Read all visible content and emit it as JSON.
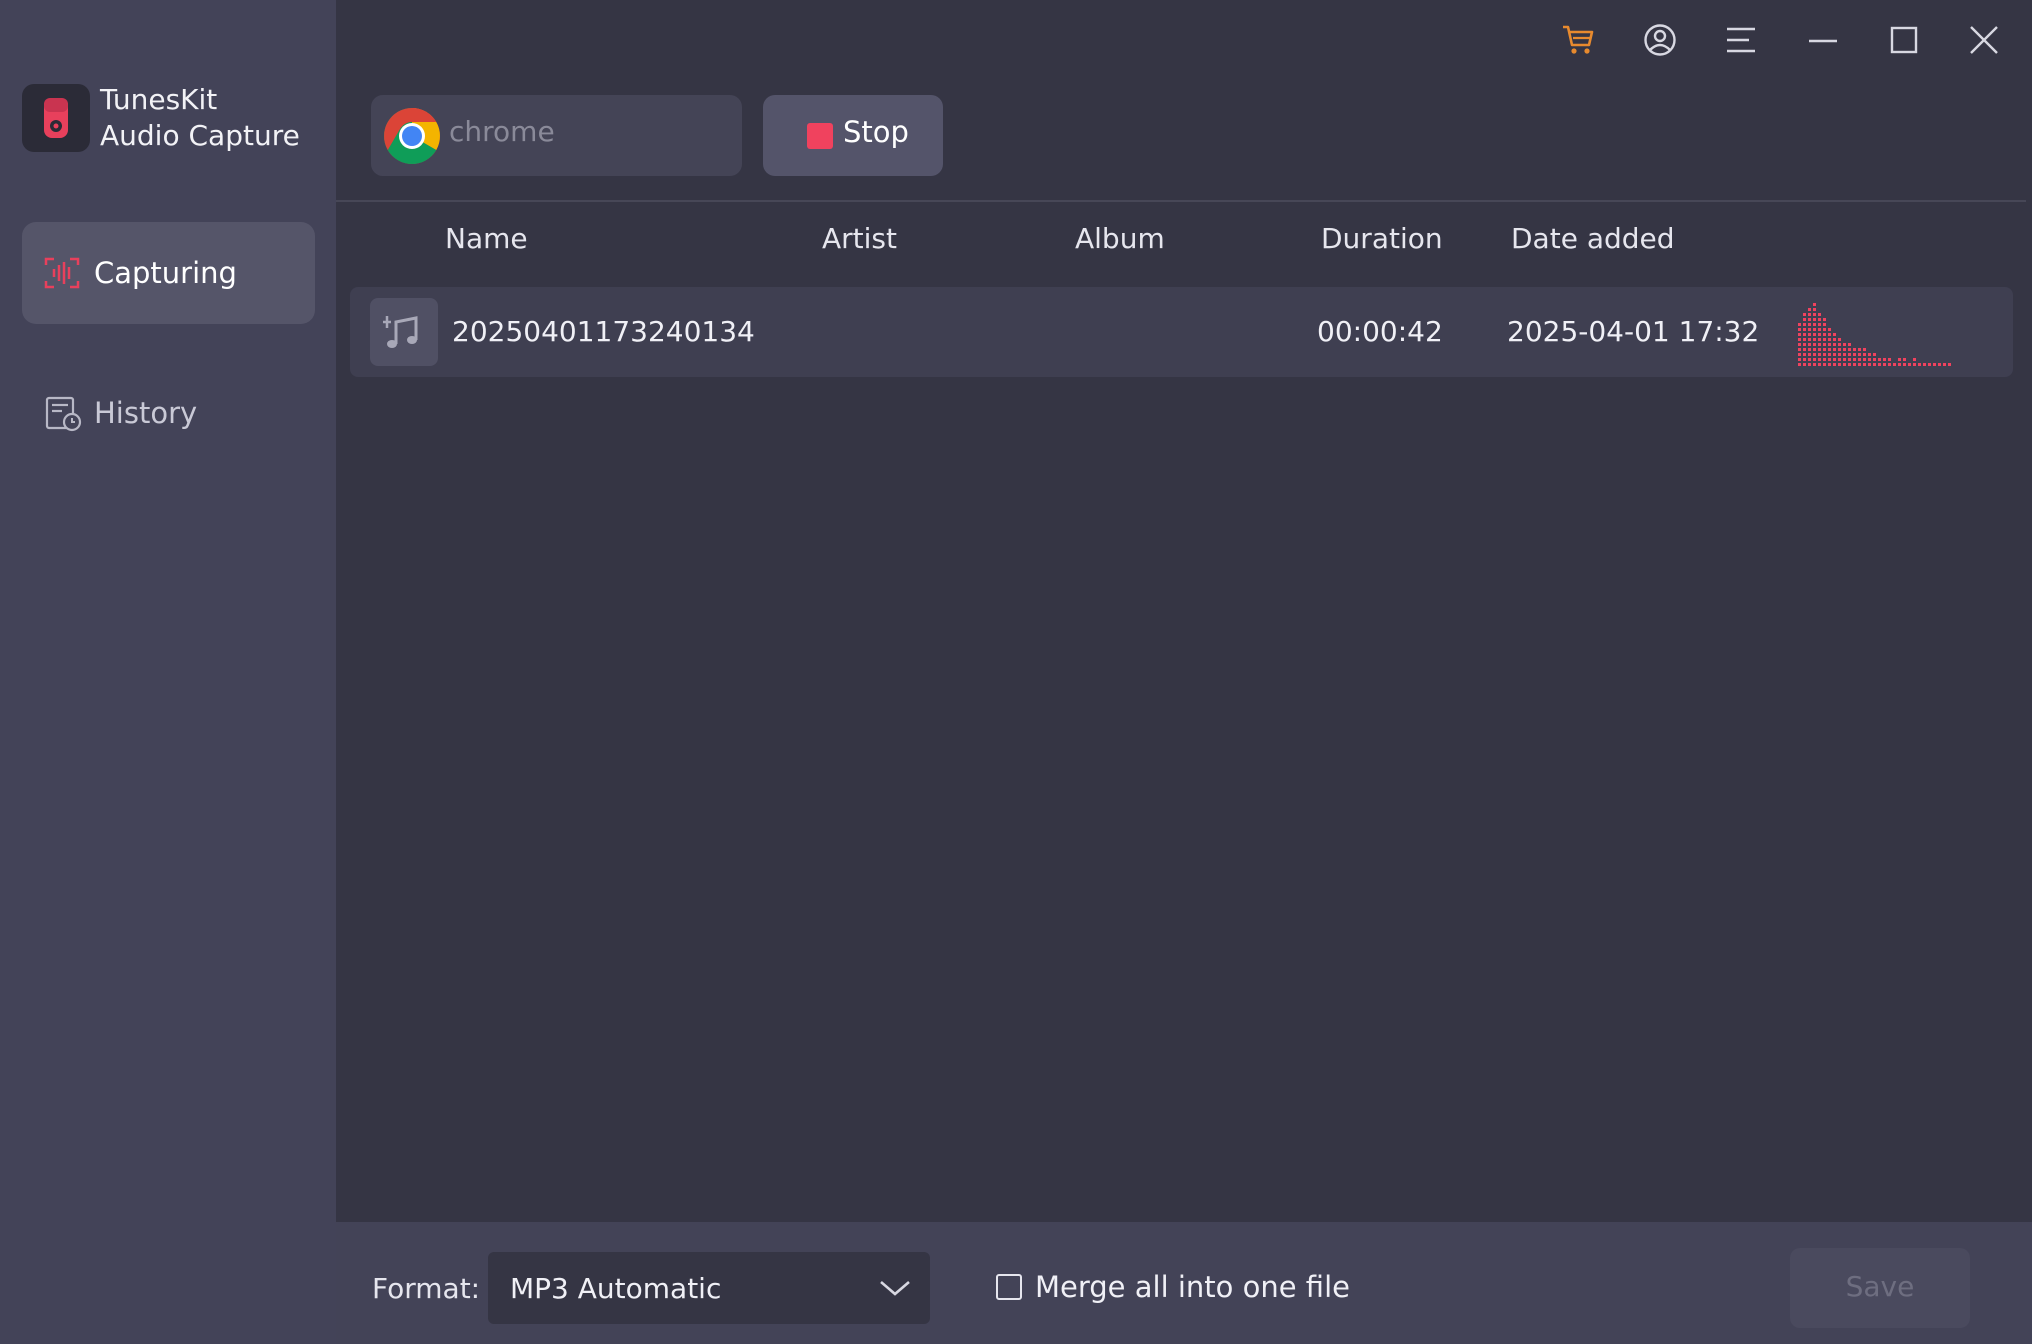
{
  "app": {
    "name_line1": "TunesKit",
    "name_line2": "Audio Capture"
  },
  "sidebar": {
    "items": [
      {
        "label": "Capturing",
        "icon": "capture-waveform-icon",
        "active": true
      },
      {
        "label": "History",
        "icon": "history-icon",
        "active": false
      }
    ]
  },
  "titlebar": {
    "icons": [
      "cart-icon",
      "account-icon",
      "menu-icon",
      "minimize-icon",
      "maximize-icon",
      "close-icon"
    ],
    "cart_color": "#e88a2e"
  },
  "toolbar": {
    "source_placeholder": "chrome",
    "source_icon": "chrome-icon",
    "stop_label": "Stop",
    "stop_color": "#f0425e"
  },
  "table": {
    "columns": [
      "Name",
      "Artist",
      "Album",
      "Duration",
      "Date added"
    ],
    "rows": [
      {
        "name": "20250401173240134",
        "artist": "",
        "album": "",
        "duration": "00:00:42",
        "date_added": "2025-04-01 17:32",
        "icon": "music-note-icon"
      }
    ]
  },
  "footer": {
    "format_label": "Format:",
    "format_value": "MP3 Automatic",
    "merge_label": "Merge all into one file",
    "merge_checked": false,
    "save_label": "Save"
  },
  "colors": {
    "accent": "#f0425e",
    "sidebar_bg": "#434358",
    "main_bg": "#353544"
  }
}
